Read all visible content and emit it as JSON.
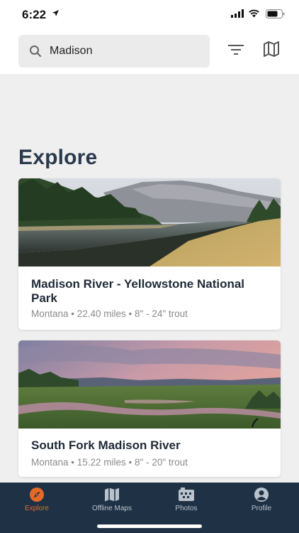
{
  "status_bar": {
    "time": "6:22"
  },
  "search": {
    "value": "Madison"
  },
  "main": {
    "heading": "Explore",
    "cards": [
      {
        "title": "Madison River - Yellowstone National Park",
        "meta": "Montana • 22.40 miles • 8\" - 24\" trout",
        "image": "river-meadow-mountains-photo"
      },
      {
        "title": "South Fork  Madison River",
        "meta": "Montana • 15.22 miles • 8\" - 20\" trout",
        "image": "river-valley-sunset-photo"
      }
    ]
  },
  "tab_bar": {
    "tabs": [
      {
        "label": "Explore",
        "icon": "compass-icon",
        "active": true
      },
      {
        "label": "Offline Maps",
        "icon": "map-icon",
        "active": false
      },
      {
        "label": "Photos",
        "icon": "photos-icon",
        "active": false
      },
      {
        "label": "Profile",
        "icon": "profile-icon",
        "active": false
      }
    ]
  },
  "colors": {
    "accent": "#e56a2a",
    "tab_bar_bg": "#1f3145",
    "heading": "#2a3a4e"
  }
}
